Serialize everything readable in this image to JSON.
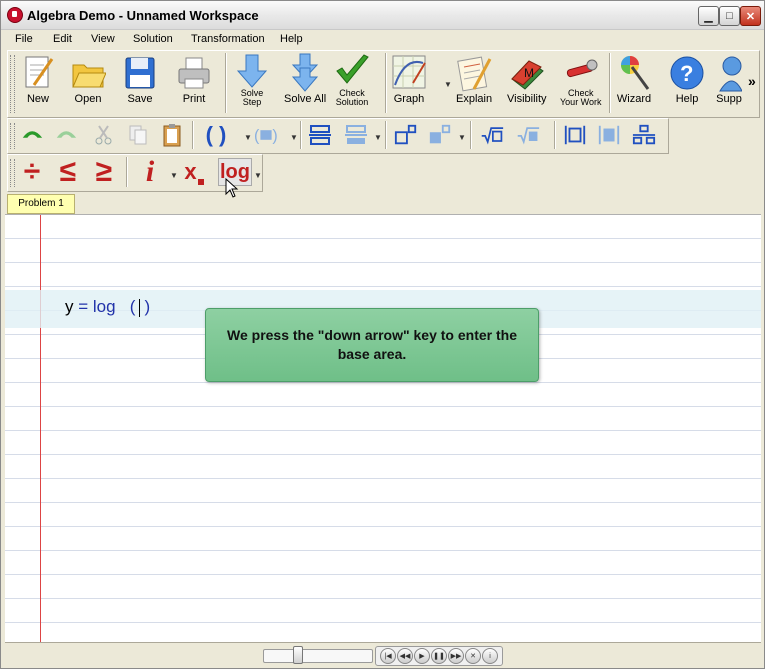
{
  "window": {
    "title": "Algebra Demo - Unnamed Workspace"
  },
  "menu": [
    "File",
    "Edit",
    "View",
    "Solution",
    "Transformation",
    "Help"
  ],
  "toolbar": {
    "new": "New",
    "open": "Open",
    "save": "Save",
    "print": "Print",
    "solve_step_1": "Solve",
    "solve_step_2": "Step",
    "solve_all": "Solve All",
    "check_solution_1": "Check",
    "check_solution_2": "Solution",
    "graph": "Graph",
    "explain": "Explain",
    "visibility": "Visibility",
    "check_work_1": "Check",
    "check_work_2": "Your Work",
    "wizard": "Wizard",
    "help": "Help",
    "support": "Supp",
    "more": "»"
  },
  "math_toolbar": {
    "divide": "÷",
    "leq": "≤",
    "geq": "≥",
    "italic_i": "i",
    "subscript_x": "x",
    "log": "log"
  },
  "tabs": [
    {
      "label": "Problem 1"
    }
  ],
  "document": {
    "formula_y": "y",
    "formula_eq": "=",
    "formula_log": "log",
    "formula_paren_open": "(",
    "formula_paren_close": ")"
  },
  "callout": {
    "text": "We press the \"down arrow\" key to enter the base area."
  },
  "colors": {
    "accent_red": "#c8102e",
    "margin_line": "#dd4444",
    "callout": "#7cc795",
    "formula": "#2233aa"
  },
  "player": {
    "controls": [
      "rewind-start",
      "rewind",
      "play",
      "pause",
      "forward",
      "stop",
      "info"
    ]
  }
}
